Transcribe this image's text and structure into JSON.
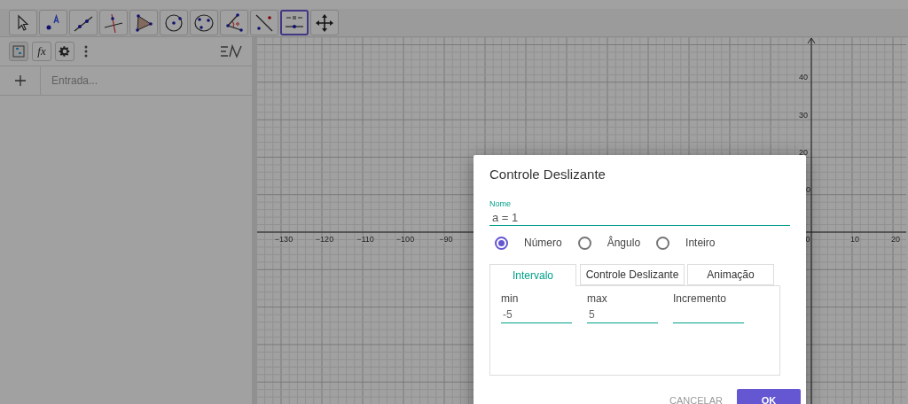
{
  "toolbar": {
    "tools": [
      {
        "kind": "move",
        "selected": false
      },
      {
        "kind": "point",
        "selected": false
      },
      {
        "kind": "line",
        "selected": false
      },
      {
        "kind": "perpendicular",
        "selected": false
      },
      {
        "kind": "polygon",
        "selected": false
      },
      {
        "kind": "circle",
        "selected": false
      },
      {
        "kind": "circle3",
        "selected": false
      },
      {
        "kind": "angle",
        "selected": false
      },
      {
        "kind": "reflect",
        "selected": false
      },
      {
        "kind": "slider",
        "selected": true
      },
      {
        "kind": "pan",
        "selected": false
      }
    ]
  },
  "algebra_panel": {
    "function_button": "fx",
    "input": {
      "placeholder": "Entrada..."
    }
  },
  "graph": {
    "x_labels": [
      "−130",
      "−120",
      "−110",
      "−100",
      "−90",
      "0",
      "10",
      "20"
    ],
    "y_labels": [
      "40",
      "30",
      "20",
      "0"
    ]
  },
  "dialog": {
    "title": "Controle Deslizante",
    "name_field": {
      "label": "Nome",
      "value": "a = 1"
    },
    "types": [
      {
        "label": "Número",
        "selected": true
      },
      {
        "label": "Ângulo",
        "selected": false
      },
      {
        "label": "Inteiro",
        "selected": false
      }
    ],
    "tabs": [
      {
        "label": "Intervalo",
        "selected": true
      },
      {
        "label": "Controle Deslizante",
        "selected": false
      },
      {
        "label": "Animação",
        "selected": false
      }
    ],
    "fields": [
      {
        "label": "min",
        "value": "-5"
      },
      {
        "label": "max",
        "value": "5"
      },
      {
        "label": "Incremento"
      }
    ],
    "buttons": [
      {
        "label": "CANCELAR",
        "kind": "text"
      },
      {
        "label": "OK",
        "kind": "primary"
      }
    ]
  }
}
